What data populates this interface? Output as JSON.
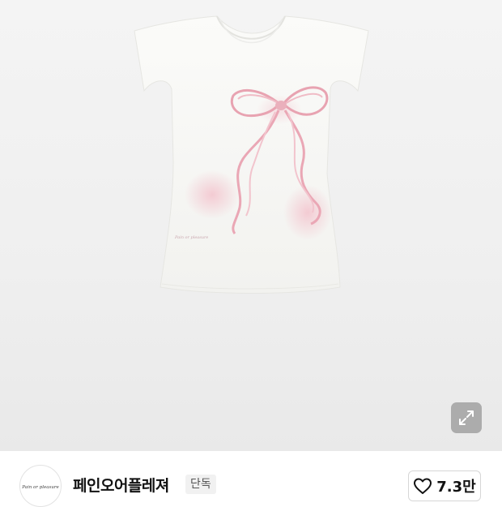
{
  "product": {
    "image_alt": "White cap-sleeve t-shirt with pink ribbon bow print",
    "print_signature": "Pain or pleasure"
  },
  "seller": {
    "name": "페인오어플레져",
    "logo_text": "Pain or pleasure",
    "badge": "단독"
  },
  "like": {
    "count": "7.3만"
  },
  "icons": {
    "expand": "expand-icon",
    "heart": "heart-icon"
  }
}
